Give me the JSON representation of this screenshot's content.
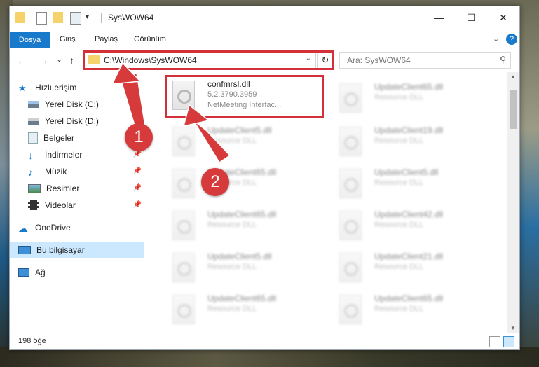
{
  "title_bar": {
    "title": "SysWOW64",
    "controls": {
      "minimize": "—",
      "maximize": "☐",
      "close": "✕"
    }
  },
  "ribbon": {
    "tabs": [
      "Dosya",
      "Giriş",
      "Paylaş",
      "Görünüm"
    ],
    "help": "?"
  },
  "address": {
    "path": "C:\\Windows\\SysWOW64",
    "back": "←",
    "forward": "→",
    "recent": "⌄",
    "up": "↑",
    "refresh": "↻",
    "search_placeholder": "Ara: SysWOW64"
  },
  "sidebar": {
    "items": [
      {
        "label": "Hızlı erişim",
        "icon": "star-icon"
      },
      {
        "label": "Yerel Disk (C:)",
        "icon": "drive-icon",
        "pinned": true
      },
      {
        "label": "Yerel Disk (D:)",
        "icon": "drive-icon",
        "pinned": true
      },
      {
        "label": "Belgeler",
        "icon": "documents-icon",
        "pinned": true
      },
      {
        "label": "İndirmeler",
        "icon": "download-icon",
        "pinned": true
      },
      {
        "label": "Müzik",
        "icon": "music-icon",
        "pinned": true
      },
      {
        "label": "Resimler",
        "icon": "pictures-icon",
        "pinned": true
      },
      {
        "label": "Videolar",
        "icon": "videos-icon",
        "pinned": true
      },
      {
        "label": "OneDrive",
        "icon": "cloud-icon"
      },
      {
        "label": "Bu bilgisayar",
        "icon": "computer-icon",
        "selected": true
      },
      {
        "label": "Ağ",
        "icon": "network-icon"
      }
    ],
    "pin_glyph": "📌"
  },
  "files": {
    "highlighted": {
      "name": "confmrsl.dll",
      "version": "5.2.3790.3959",
      "description": "NetMeeting Interfac..."
    },
    "blurred": [
      {
        "name": "UpdateClient65.dll",
        "desc": "Resource DLL"
      },
      {
        "name": "UpdateClient5.dll",
        "desc": "Resource DLL"
      },
      {
        "name": "UpdateClient19.dll",
        "desc": "Resource DLL"
      },
      {
        "name": "UpdateClient65.dll",
        "desc": "Resource DLL"
      },
      {
        "name": "UpdateClient5.dll",
        "desc": "Resource DLL"
      },
      {
        "name": "UpdateClient65.dll",
        "desc": "Resource DLL"
      },
      {
        "name": "UpdateClient42.dll",
        "desc": "Resource DLL"
      },
      {
        "name": "UpdateClient5.dll",
        "desc": "Resource DLL"
      },
      {
        "name": "UpdateClient21.dll",
        "desc": "Resource DLL"
      },
      {
        "name": "UpdateClient65.dll",
        "desc": "Resource DLL"
      },
      {
        "name": "UpdateClient65.dll",
        "desc": "Resource DLL"
      }
    ]
  },
  "status": {
    "count": "198 öğe"
  },
  "annotations": {
    "badge1": "1",
    "badge2": "2"
  },
  "colors": {
    "accent": "#1979ca",
    "highlight": "#d3303a",
    "selection": "#cce8ff"
  }
}
